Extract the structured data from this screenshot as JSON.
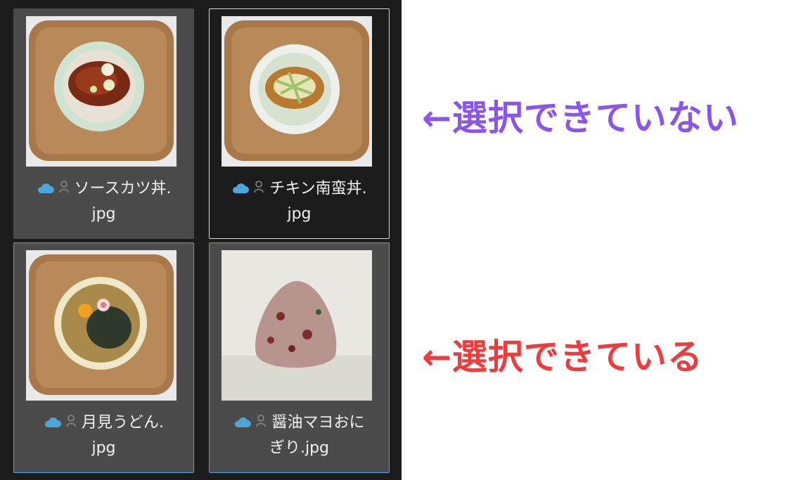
{
  "files": [
    {
      "name_line1": "ソースカツ丼.",
      "name_line2": "jpg",
      "state": "selected",
      "thumbnail": "sauce-katsudon-photo"
    },
    {
      "name_line1": "チキン南蛮丼.",
      "name_line2": "jpg",
      "state": "outline",
      "thumbnail": "chicken-nanban-don-photo"
    },
    {
      "name_line1": "月見うどん.",
      "name_line2": "jpg",
      "state": "selected-highlight",
      "thumbnail": "tsukimi-udon-photo"
    },
    {
      "name_line1": "醤油マヨおに",
      "name_line2": "ぎり.jpg",
      "state": "selected-highlight",
      "thumbnail": "onigiri-photo"
    }
  ],
  "icons": {
    "cloud": "cloud-icon",
    "person": "person-icon"
  },
  "annotations": {
    "not_selectable": "←選択できていない",
    "selectable": "←選択できている"
  },
  "colors": {
    "panel_bg": "#1c1c1c",
    "tile_bg": "#4b4b4b",
    "selection_border": "#4aa7dc",
    "outline_border": "#d9d9d9",
    "cloud": "#4aa7dc",
    "annotation_purple": "#8a55ef",
    "annotation_red": "#f23a3a"
  }
}
